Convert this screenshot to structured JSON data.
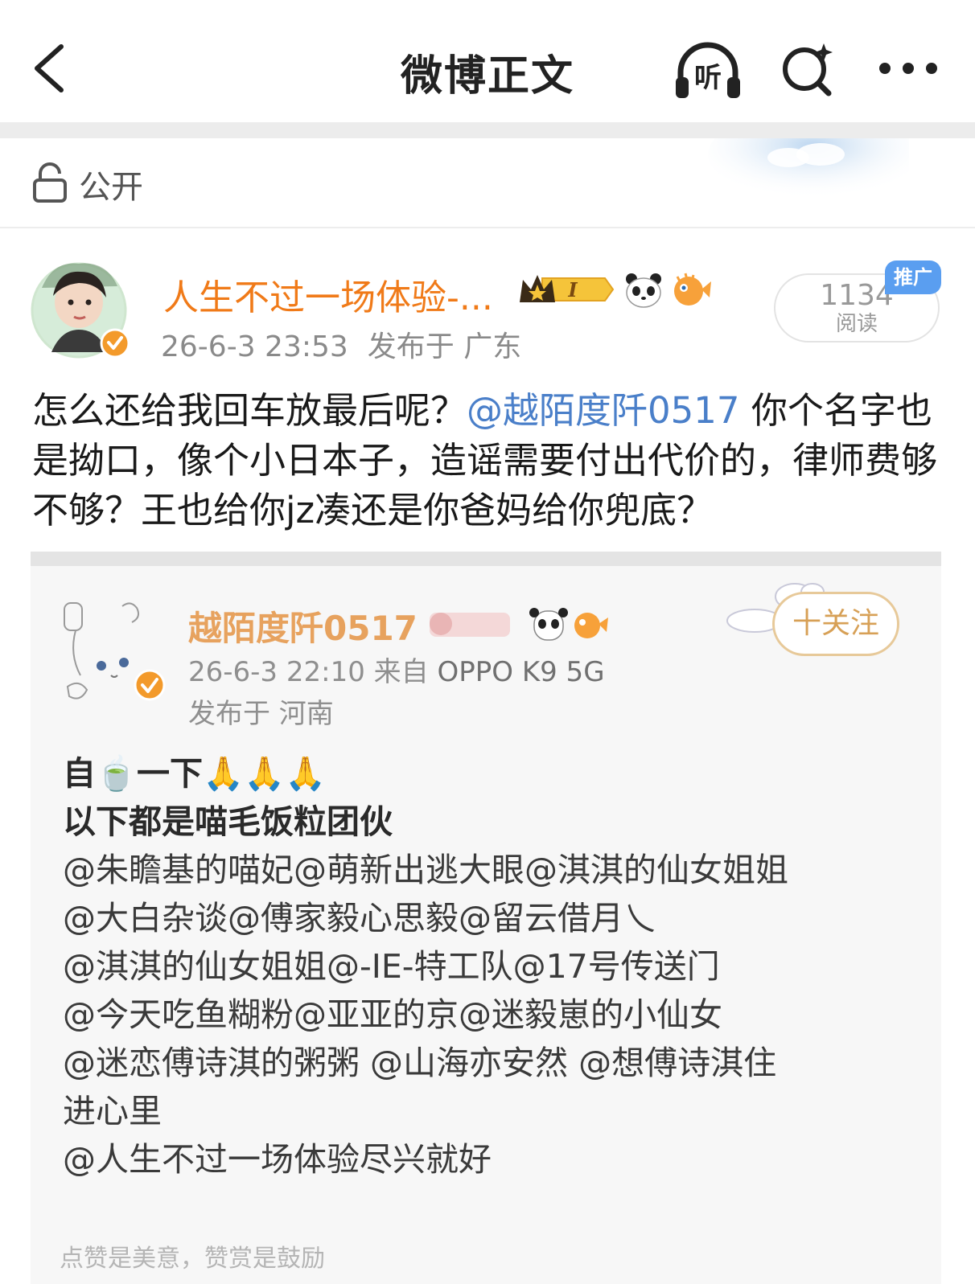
{
  "nav": {
    "title": "微博正文",
    "listen_label": "听"
  },
  "visibility": {
    "label": "公开"
  },
  "post": {
    "author_name": "人生不过一场体验-...",
    "vip_level": "I",
    "date": "26-6-3 23:53",
    "location": "发布于 广东",
    "read_count": "1134",
    "read_label": "阅读",
    "promo_tag": "推广",
    "text_before": "怎么还给我回车放最后呢？",
    "mention": "@越陌度阡0517",
    "text_after": "  你个名字也是拗口，像个小日本子，造谣需要付出代价的，律师费够不够？王也给你jz凑还是你爸妈给你兜底？"
  },
  "screenshot": {
    "name": "越陌度阡0517",
    "date_source": "26-6-3 22:10  来自",
    "device": "OPPO K9 5G",
    "location": "发布于 河南",
    "follow_label": "十关注",
    "lines": [
      "自🍵一下🙏🙏🙏",
      "以下都是喵毛饭粒团伙",
      "@朱瞻基的喵妃@萌新出逃大眼@淇淇的仙女姐姐",
      "@大白杂谈@傅家毅心思毅@留云借月乀",
      "@淇淇的仙女姐姐@-IE-特工队@17号传送门",
      "@今天吃鱼糊粉@亚亚的京@迷毅崽的小仙女",
      " @迷恋傅诗淇的粥粥 @山海亦安然  @想傅诗淇住",
      "进心里",
      "@人生不过一场体验尽兴就好"
    ],
    "footer": "点赞是美意，赞赏是鼓励"
  },
  "colors": {
    "author_orange": "#f07a18",
    "mention_blue": "#4a7fc9",
    "promo_blue": "#5a9ef0",
    "verified_orange": "#f39a2b"
  },
  "icons": [
    "back-arrow-icon",
    "headphones-icon",
    "search-sparkle-icon",
    "more-dots-icon",
    "lock-open-icon",
    "verified-icon",
    "panda-icon",
    "fish-icon",
    "crown-icon"
  ]
}
